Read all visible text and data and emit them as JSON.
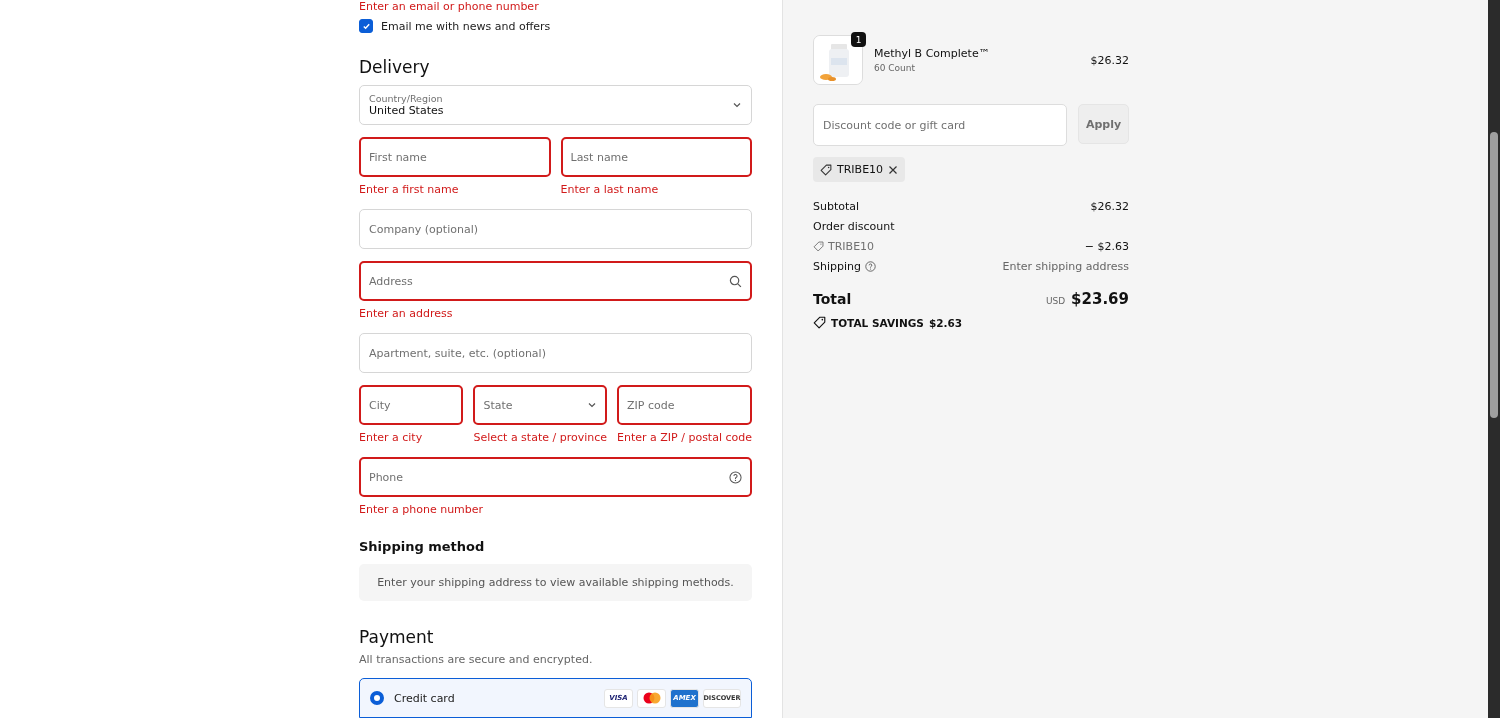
{
  "contact": {
    "error": "Enter an email or phone number",
    "newsletter": {
      "label": "Email me with news and offers",
      "checked": true
    }
  },
  "delivery": {
    "title": "Delivery",
    "rows": [
      [
        {
          "kind": "select",
          "label": "Country/Region",
          "value": "United States",
          "invalid": false
        }
      ],
      [
        {
          "kind": "input",
          "placeholder": "First name",
          "invalid": true,
          "error": "Enter a first name"
        },
        {
          "kind": "input",
          "placeholder": "Last name",
          "invalid": true,
          "error": "Enter a last name"
        }
      ],
      [
        {
          "kind": "input",
          "placeholder": "Company (optional)",
          "invalid": false
        }
      ],
      [
        {
          "kind": "search",
          "placeholder": "Address",
          "invalid": true,
          "error": "Enter an address"
        }
      ],
      [
        {
          "kind": "input",
          "placeholder": "Apartment, suite, etc. (optional)",
          "invalid": false
        }
      ],
      [
        {
          "kind": "input",
          "placeholder": "City",
          "invalid": true,
          "error": "Enter a city"
        },
        {
          "kind": "select",
          "placeholder": "State",
          "invalid": true,
          "error": "Select a state / province"
        },
        {
          "kind": "input",
          "placeholder": "ZIP code",
          "invalid": true,
          "error": "Enter a ZIP / postal code"
        }
      ],
      [
        {
          "kind": "phone",
          "placeholder": "Phone",
          "invalid": true,
          "error": "Enter a phone number"
        }
      ]
    ]
  },
  "shipping_method": {
    "title": "Shipping method",
    "notice": "Enter your shipping address to view available shipping methods."
  },
  "payment": {
    "title": "Payment",
    "subtitle": "All transactions are secure and encrypted.",
    "methods": [
      {
        "label": "Credit card",
        "selected": true,
        "cards": [
          {
            "kind": "visa",
            "label": "VISA"
          },
          {
            "kind": "mastercard"
          },
          {
            "kind": "amex",
            "label": "AMEX"
          },
          {
            "kind": "discover",
            "label": "DISCOVER"
          }
        ]
      }
    ]
  },
  "summary": {
    "item": {
      "quantity": "1",
      "name": "Methyl B Complete™",
      "variant": "60 Count",
      "price": "$26.32"
    },
    "discount": {
      "placeholder": "Discount code or gift card",
      "button": "Apply"
    },
    "applied_code": "TRIBE10",
    "lines": [
      {
        "kind": "plain",
        "label": "Subtotal",
        "value": "$26.32"
      },
      {
        "kind": "heading",
        "label": "Order discount"
      },
      {
        "kind": "code",
        "label": "TRIBE10",
        "value": "− $2.63"
      },
      {
        "kind": "help",
        "label": "Shipping",
        "value": "Enter shipping address"
      }
    ],
    "total": {
      "label": "Total",
      "currency": "USD",
      "value": "$23.69"
    },
    "savings": {
      "label": "TOTAL SAVINGS",
      "value": "$2.63"
    }
  }
}
